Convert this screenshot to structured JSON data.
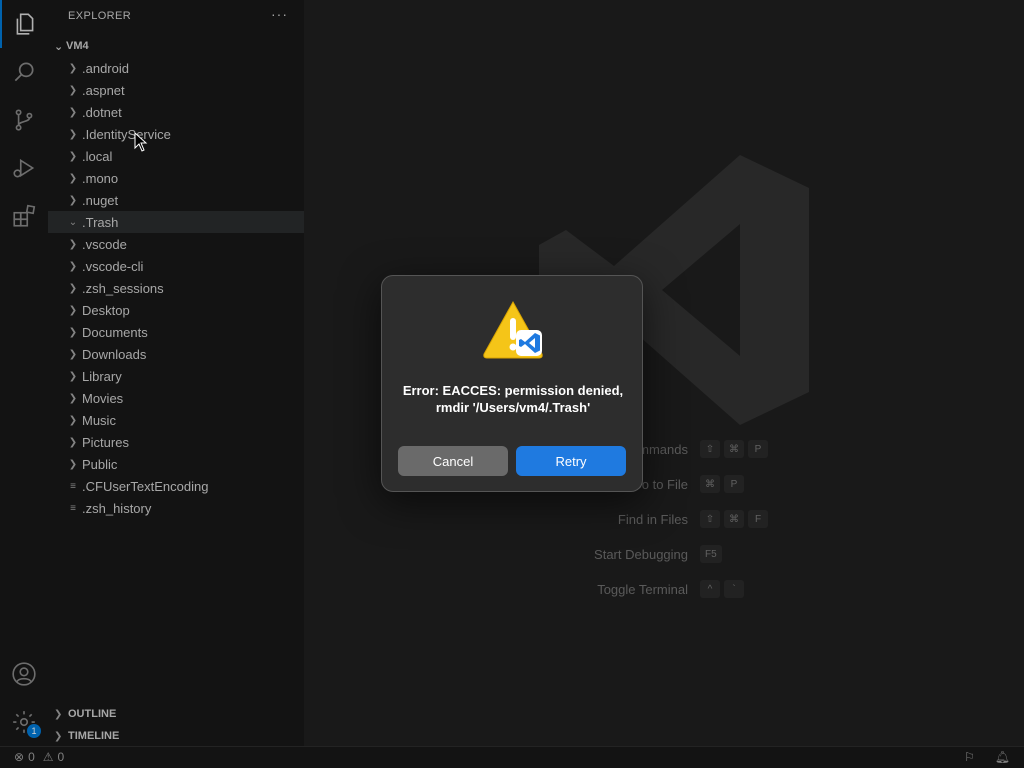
{
  "sidebar": {
    "header": "EXPLORER",
    "more": "···",
    "root": "VM4",
    "items": [
      {
        "label": ".android",
        "type": "folder"
      },
      {
        "label": ".aspnet",
        "type": "folder"
      },
      {
        "label": ".dotnet",
        "type": "folder"
      },
      {
        "label": ".IdentityService",
        "type": "folder"
      },
      {
        "label": ".local",
        "type": "folder"
      },
      {
        "label": ".mono",
        "type": "folder"
      },
      {
        "label": ".nuget",
        "type": "folder"
      },
      {
        "label": ".Trash",
        "type": "folder",
        "expanded": true,
        "selected": true
      },
      {
        "label": ".vscode",
        "type": "folder"
      },
      {
        "label": ".vscode-cli",
        "type": "folder"
      },
      {
        "label": ".zsh_sessions",
        "type": "folder"
      },
      {
        "label": "Desktop",
        "type": "folder"
      },
      {
        "label": "Documents",
        "type": "folder"
      },
      {
        "label": "Downloads",
        "type": "folder"
      },
      {
        "label": "Library",
        "type": "folder"
      },
      {
        "label": "Movies",
        "type": "folder"
      },
      {
        "label": "Music",
        "type": "folder"
      },
      {
        "label": "Pictures",
        "type": "folder"
      },
      {
        "label": "Public",
        "type": "folder"
      },
      {
        "label": ".CFUserTextEncoding",
        "type": "file"
      },
      {
        "label": ".zsh_history",
        "type": "file"
      }
    ],
    "panels": {
      "outline": "OUTLINE",
      "timeline": "TIMELINE"
    }
  },
  "activity": {
    "icons": [
      "files-icon",
      "search-icon",
      "source-control-icon",
      "run-debug-icon",
      "extensions-icon",
      "account-icon",
      "settings-icon"
    ],
    "settings_badge": "1"
  },
  "editor": {
    "shortcuts": [
      {
        "label": "Show All Commands",
        "keys": [
          "⇧",
          "⌘",
          "P"
        ]
      },
      {
        "label": "Go to File",
        "keys": [
          "⌘",
          "P"
        ]
      },
      {
        "label": "Find in Files",
        "keys": [
          "⇧",
          "⌘",
          "F"
        ]
      },
      {
        "label": "Start Debugging",
        "keys": [
          "F5"
        ]
      },
      {
        "label": "Toggle Terminal",
        "keys": [
          "^",
          "`"
        ]
      }
    ]
  },
  "dialog": {
    "message": "Error: EACCES: permission denied, rmdir '/Users/vm4/.Trash'",
    "cancel_label": "Cancel",
    "retry_label": "Retry"
  },
  "statusbar": {
    "errors": "0",
    "warnings": "0"
  },
  "colors": {
    "accent": "#0078d4",
    "retry_button": "#1f7ae0",
    "warning_yellow": "#f5c518"
  }
}
